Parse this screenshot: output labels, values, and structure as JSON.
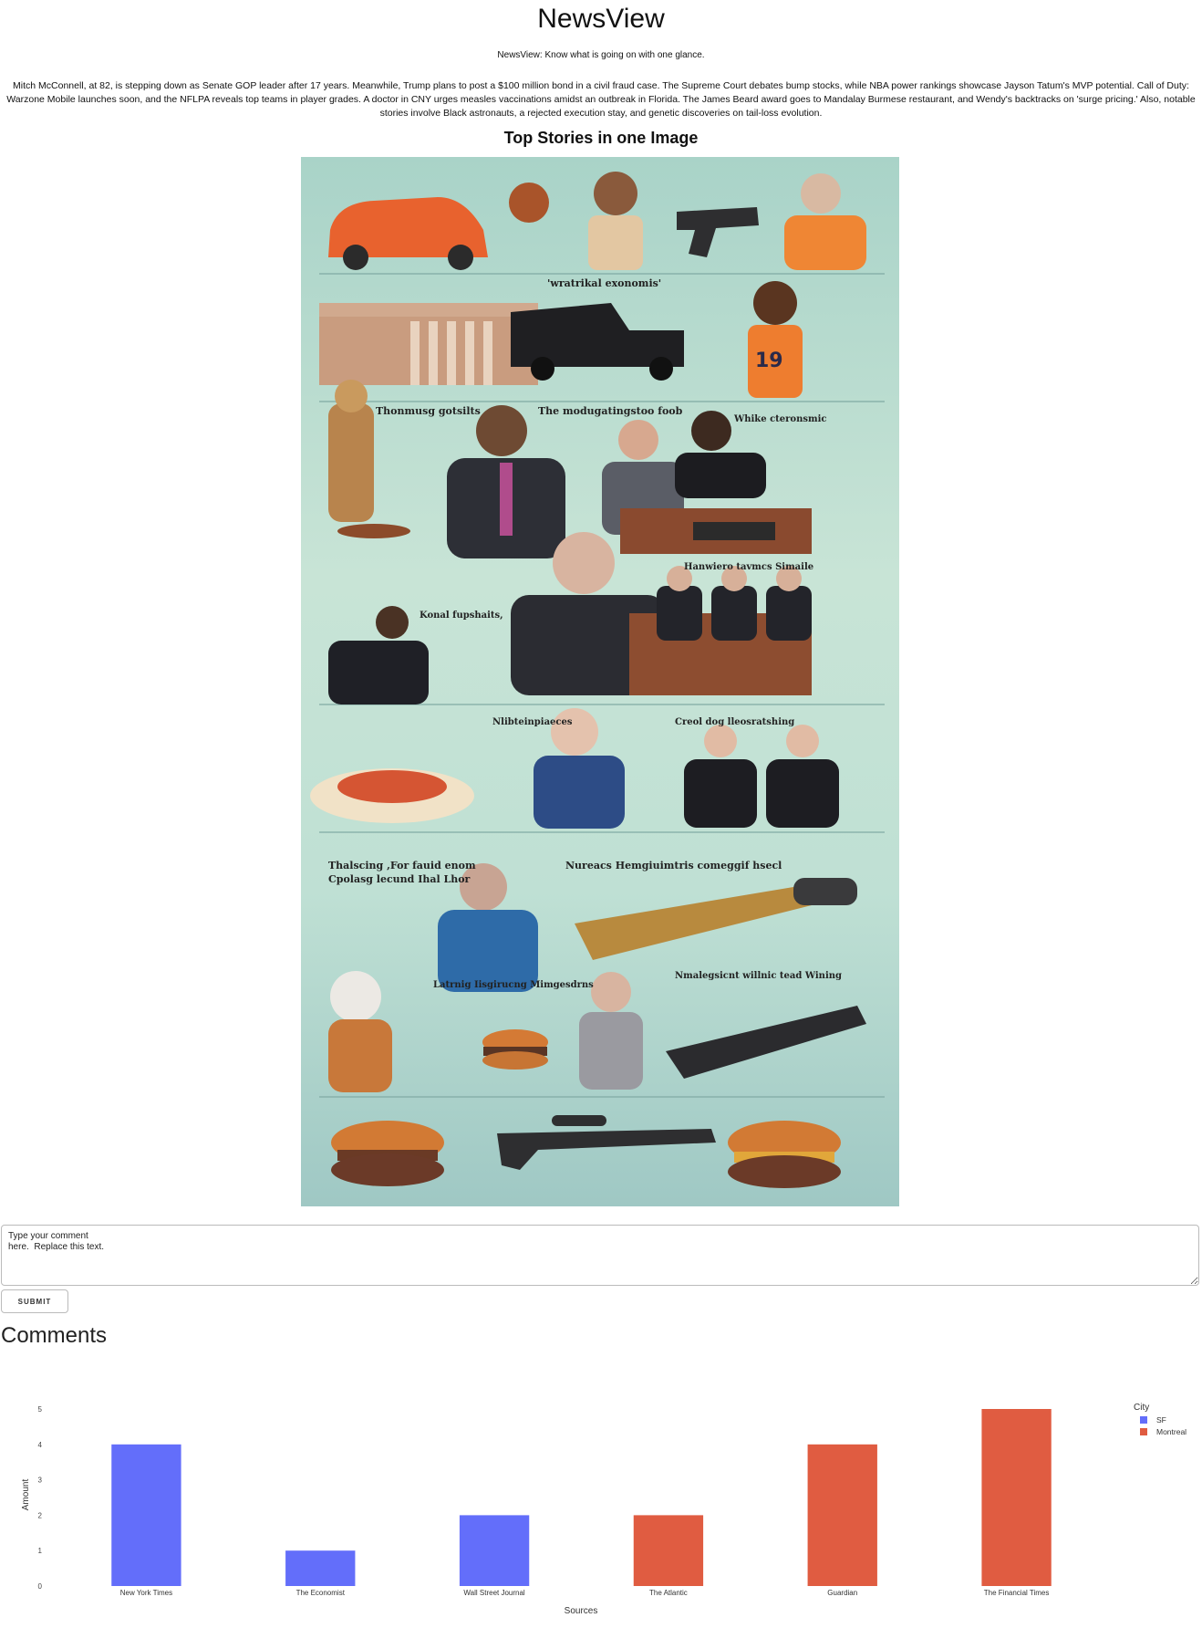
{
  "header": {
    "title": "NewsView",
    "tagline": "NewsView: Know what is going on with one glance.",
    "summary": "Mitch McConnell, at 82, is stepping down as Senate GOP leader after 17 years. Meanwhile, Trump plans to post a $100 million bond in a civil fraud case. The Supreme Court debates bump stocks, while NBA power rankings showcase Jayson Tatum's MVP potential. Call of Duty: Warzone Mobile launches soon, and the NFLPA reveals top teams in player grades. A doctor in CNY urges measles vaccinations amidst an outbreak in Florida. The James Beard award goes to Mandalay Burmese restaurant, and Wendy's backtracks on 'surge pricing.' Also, notable stories involve Black astronauts, a rejected execution stay, and genetic discoveries on tail-loss evolution."
  },
  "top_stories": {
    "heading": "Top Stories in one Image"
  },
  "comment_form": {
    "value": "Type your comment\nhere.  Replace this text.",
    "submit_label": "Submit"
  },
  "comments": {
    "heading": "Comments"
  },
  "colors": {
    "sf": "#636efa",
    "montreal": "#e05c41"
  },
  "chart_data": {
    "type": "bar",
    "xlabel": "Sources",
    "ylabel": "Amount",
    "ylim": [
      0,
      5
    ],
    "yticks": [
      "0",
      "1",
      "2",
      "3",
      "4",
      "5"
    ],
    "grid": false,
    "legend": {
      "title": "City",
      "placement": "top-right"
    },
    "categories": [
      "New York Times",
      "The Economist",
      "Wall Street Journal",
      "The Atlantic",
      "Guardian",
      "The Financial Times"
    ],
    "series": [
      {
        "name": "SF",
        "color": "#636efa",
        "values": [
          4,
          1,
          2,
          null,
          null,
          null
        ]
      },
      {
        "name": "Montreal",
        "color": "#e05c41",
        "values": [
          null,
          null,
          null,
          2,
          4,
          5
        ]
      }
    ]
  }
}
